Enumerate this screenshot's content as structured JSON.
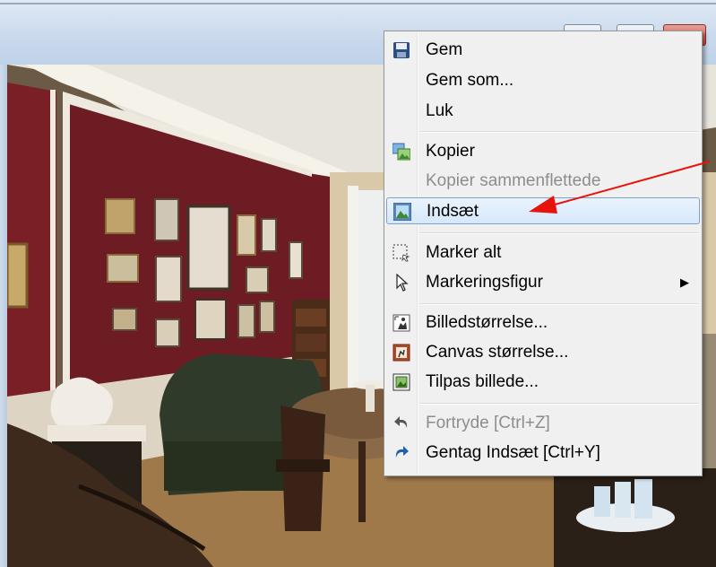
{
  "menu": {
    "items": [
      {
        "label": "Gem",
        "icon": "save-icon",
        "enabled": true
      },
      {
        "label": "Gem som...",
        "icon": "",
        "enabled": true
      },
      {
        "label": "Luk",
        "icon": "",
        "enabled": true
      },
      {
        "label": "Kopier",
        "icon": "copy-image-icon",
        "enabled": true
      },
      {
        "label": "Kopier sammenflettede",
        "icon": "",
        "enabled": false
      },
      {
        "label": "Indsæt",
        "icon": "paste-image-icon",
        "enabled": true,
        "highlighted": true
      },
      {
        "label": "Marker alt",
        "icon": "select-all-icon",
        "enabled": true
      },
      {
        "label": "Markeringsfigur",
        "icon": "cursor-icon",
        "enabled": true,
        "submenu": true
      },
      {
        "label": "Billedstørrelse...",
        "icon": "image-size-icon",
        "enabled": true
      },
      {
        "label": "Canvas størrelse...",
        "icon": "canvas-size-icon",
        "enabled": true
      },
      {
        "label": "Tilpas billede...",
        "icon": "fit-image-icon",
        "enabled": true
      },
      {
        "label": "Fortryde [Ctrl+Z]",
        "icon": "undo-icon",
        "enabled": false
      },
      {
        "label": "Gentag Indsæt [Ctrl+Y]",
        "icon": "redo-icon",
        "enabled": true
      }
    ]
  },
  "colors": {
    "menu_bg": "#f0f0f0",
    "highlight": "#d6e8fb",
    "disabled_text": "#8d8d8d",
    "annotation_arrow": "#e8140c"
  },
  "window_buttons": [
    "minimize-button",
    "maximize-button",
    "close-button"
  ]
}
